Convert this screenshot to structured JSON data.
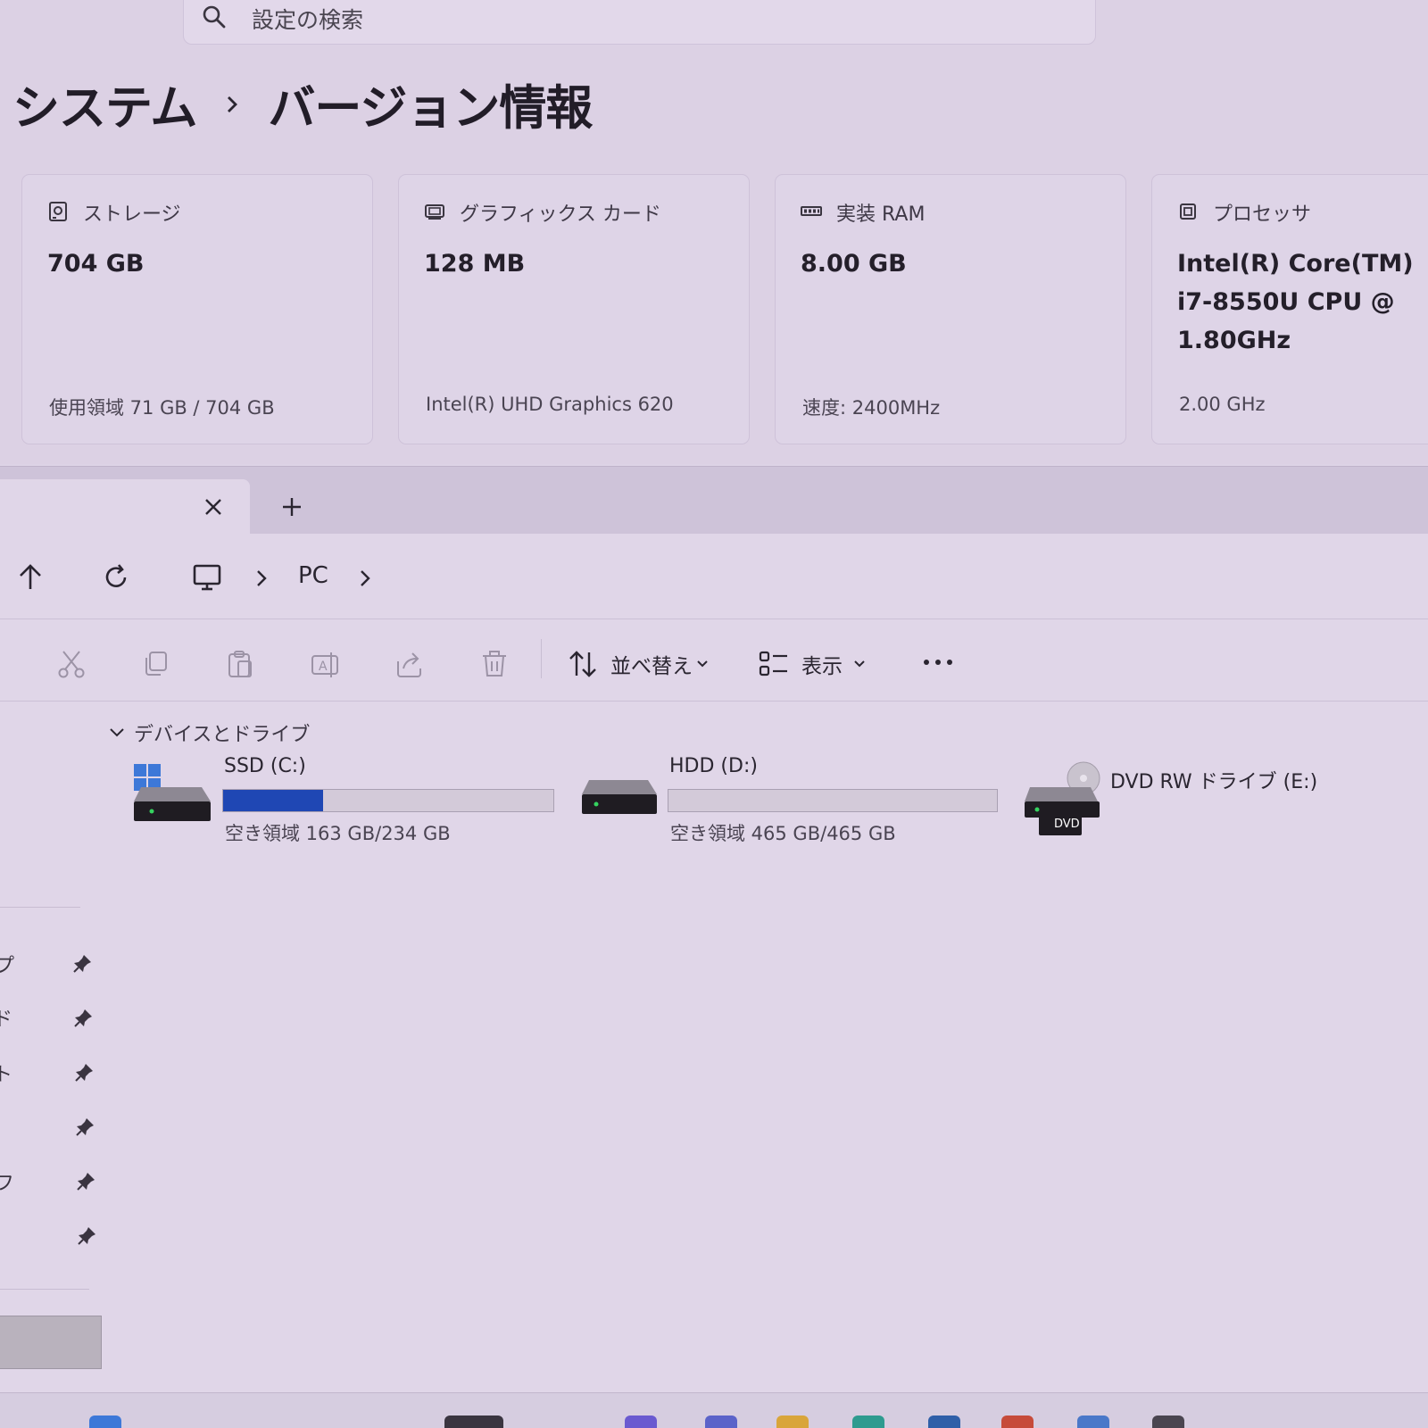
{
  "settings": {
    "search_placeholder": "設定の検索",
    "breadcrumb": {
      "parent": "システム",
      "current": "バージョン情報"
    },
    "cards": [
      {
        "icon": "storage-icon",
        "label": "ストレージ",
        "value": "704 GB",
        "sub": "使用領域 71 GB / 704 GB"
      },
      {
        "icon": "graphics-card-icon",
        "label": "グラフィックス カード",
        "value": "128 MB",
        "sub": "Intel(R) UHD Graphics 620"
      },
      {
        "icon": "ram-icon",
        "label": "実装 RAM",
        "value": "8.00 GB",
        "sub": "速度: 2400MHz"
      },
      {
        "icon": "processor-icon",
        "label": "プロセッサ",
        "value": "Intel(R) Core(TM) i7-8550U CPU @ 1.80GHz",
        "sub": "2.00 GHz"
      }
    ]
  },
  "explorer": {
    "address": {
      "location": "PC"
    },
    "toolbar": {
      "sort_label": "並べ替え",
      "view_label": "表示"
    },
    "section_title": "デバイスとドライブ",
    "drives": [
      {
        "name": "SSD (C:)",
        "free_text": "空き領域 163 GB/234 GB",
        "used_fraction": 0.303,
        "icon": "windows-drive-icon"
      },
      {
        "name": "HDD (D:)",
        "free_text": "空き領域 465 GB/465 GB",
        "used_fraction": 0.0,
        "icon": "hard-drive-icon"
      },
      {
        "name": "DVD RW ドライブ (E:)",
        "badge": "DVD",
        "icon": "dvd-drive-icon"
      }
    ],
    "sidebar_fragments": [
      "プ",
      "ド",
      "ト",
      "",
      "フ",
      ""
    ]
  },
  "colors": {
    "accent": "#1f47b4",
    "background": "#ddd3e6"
  }
}
